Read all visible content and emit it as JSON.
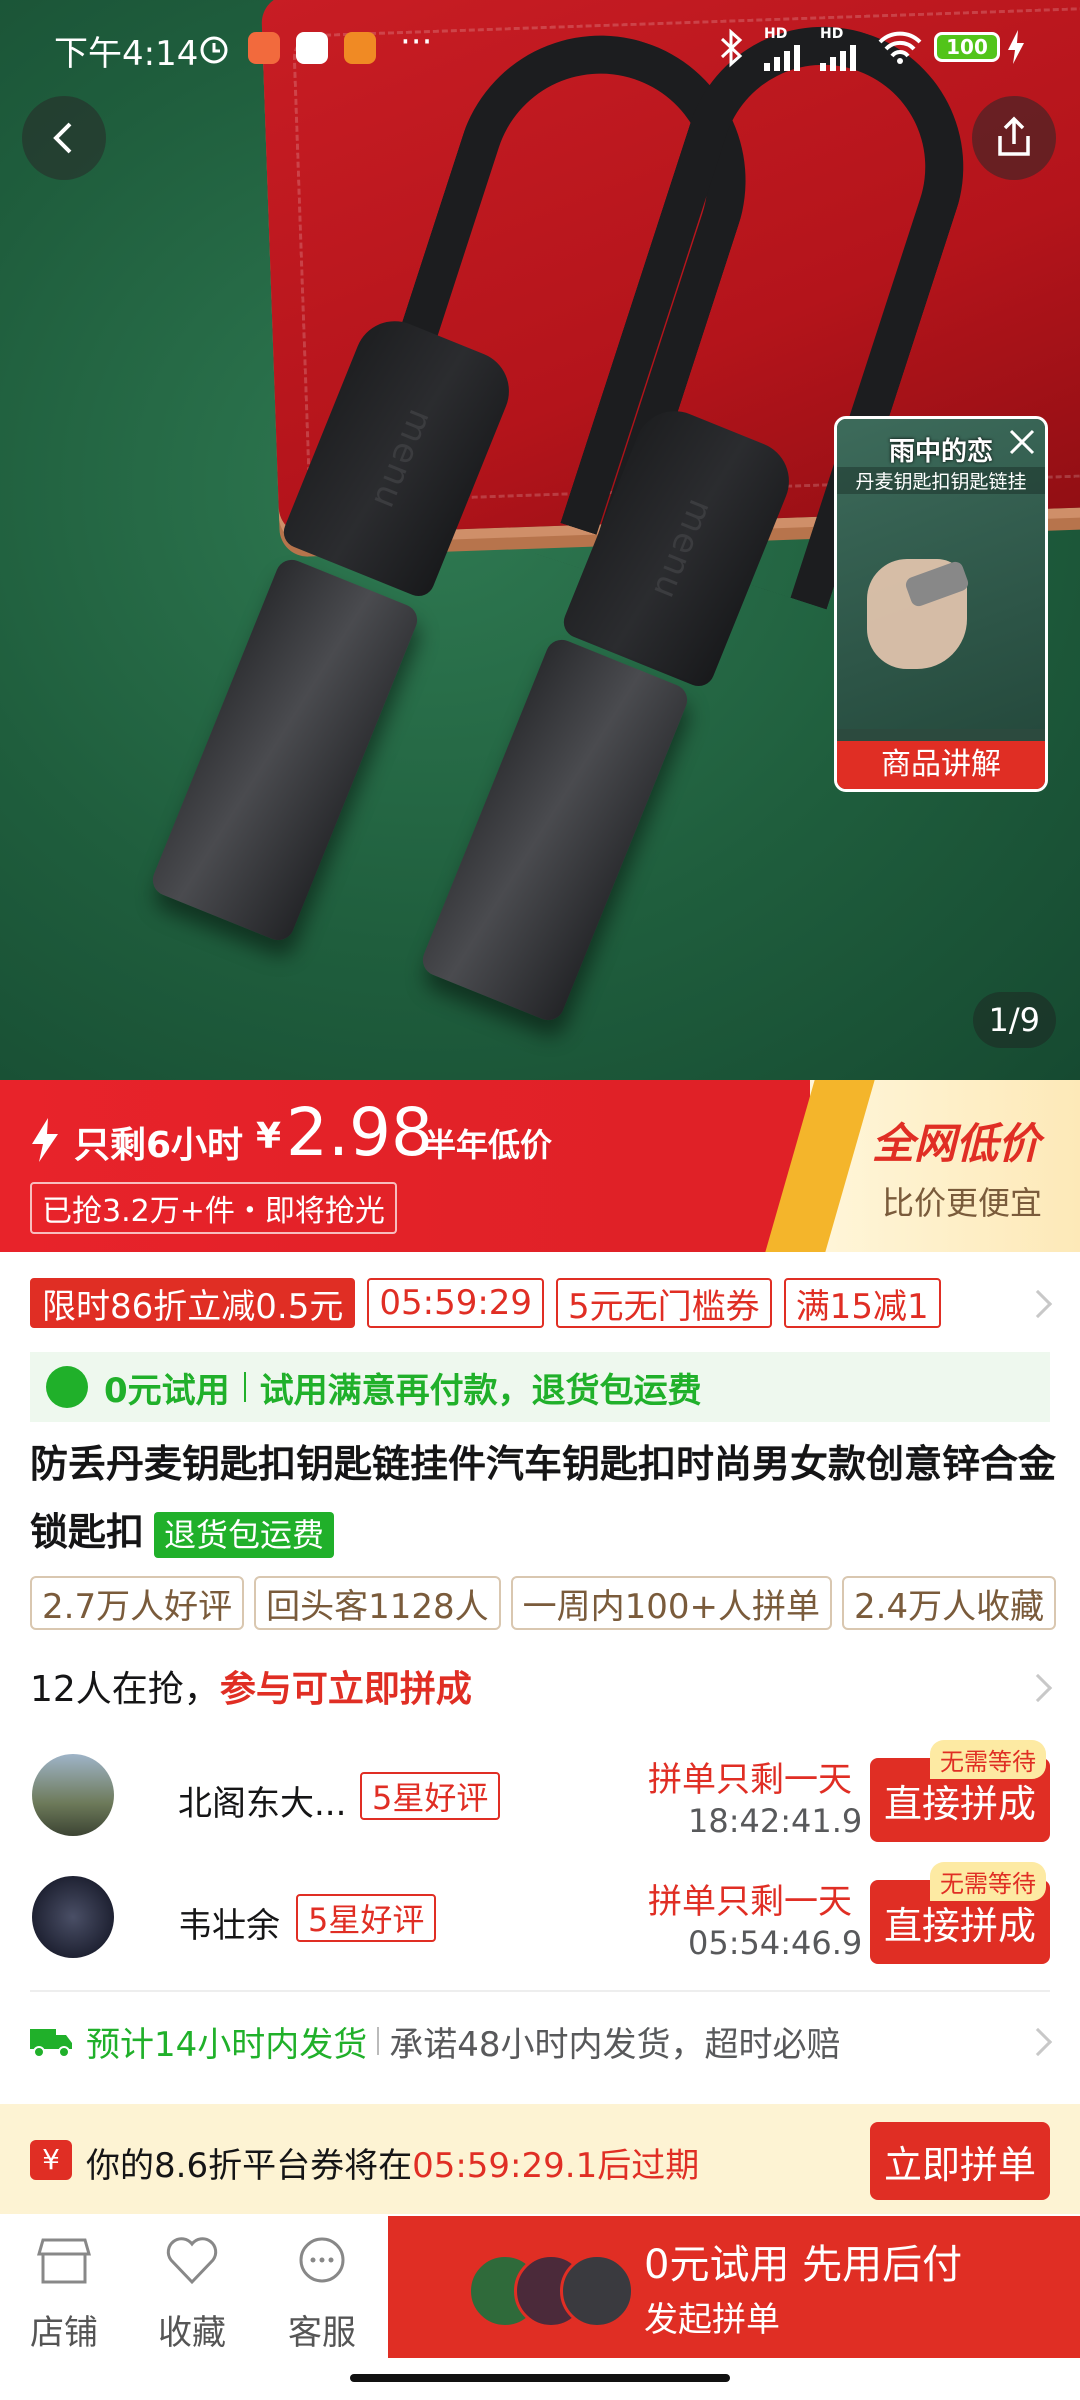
{
  "status_bar": {
    "time": "下午4:14",
    "more": "···",
    "hd1": "HD",
    "hd2": "HD",
    "battery": "100"
  },
  "hero": {
    "pager": "1/9",
    "key_logo": "menu",
    "video_card": {
      "overlay_title": "雨中的恋",
      "overlay_subtitle": "丹麦钥匙扣钥匙链挂",
      "caption": "商品讲解"
    }
  },
  "promo": {
    "flash_prefix": "只剩6小时",
    "currency": "¥",
    "price": "2.98",
    "price_note": "半年低价",
    "sold": "已抢3.2万+件・即将抢光",
    "right_title": "全网低价",
    "right_sub": "比价更便宜"
  },
  "coupons": {
    "items": [
      "限时86折立减0.5元",
      "05:59:29",
      "5元无门槛券",
      "满15减1"
    ]
  },
  "trial_bar": {
    "left": "0元试用",
    "right": "试用满意再付款，退货包运费"
  },
  "product": {
    "title": "防丢丹麦钥匙扣钥匙链挂件汽车钥匙扣时尚男女款创意锌合金锁匙扣",
    "badge": "退货包运费"
  },
  "stats": [
    "2.7万人好评",
    "回头客1128人",
    "一周内100+人拼单",
    "2.4万人收藏"
  ],
  "group": {
    "count_text": "12人在抢，",
    "cta_text": "参与可立即拼成",
    "rows": [
      {
        "name": "北阁东大...",
        "rating": "5星好评",
        "remain": "拼单只剩一天",
        "timer": "18:42:41.9",
        "badge": "无需等待",
        "button": "直接拼成"
      },
      {
        "name": "韦壮余",
        "rating": "5星好评",
        "remain": "拼单只剩一天",
        "timer": "05:54:46.9",
        "badge": "无需等待",
        "button": "直接拼成"
      }
    ]
  },
  "shipping": {
    "left": "预计14小时内发货",
    "right": "承诺48小时内发货，超时必赔"
  },
  "coupon_notice": {
    "prefix": "你的8.6折平台券将在",
    "timer": "05:59:29.1后过期",
    "button": "立即拼单"
  },
  "bottom_nav": {
    "store": "店铺",
    "favorite": "收藏",
    "service": "客服",
    "cta_main": "0元试用 先用后付",
    "cta_sub": "发起拼单"
  },
  "colors": {
    "accent_red": "#e02e24",
    "green": "#20b02a",
    "promo_gold": "#f4b52b"
  }
}
